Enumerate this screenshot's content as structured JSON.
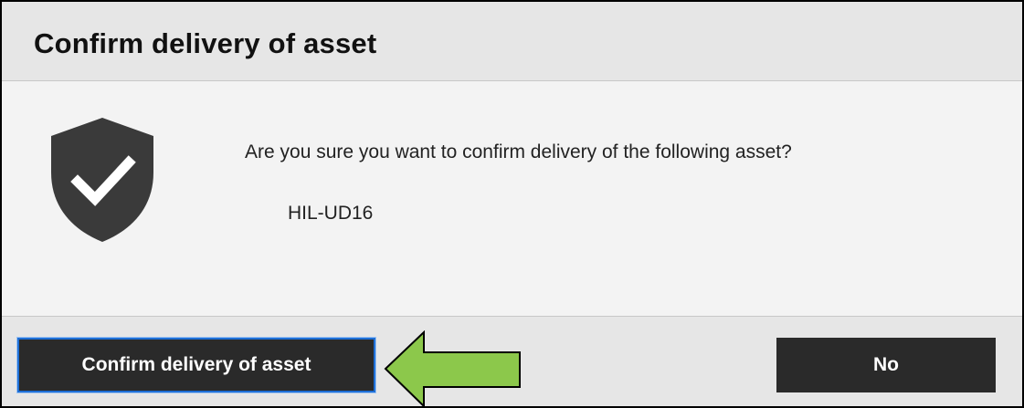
{
  "dialog": {
    "title": "Confirm delivery of asset",
    "message": "Are you sure you want to confirm delivery of the following asset?",
    "asset_name": "HIL-UD16",
    "icon": "shield-check-icon"
  },
  "buttons": {
    "confirm_label": "Confirm delivery of asset",
    "no_label": "No"
  },
  "annotation": {
    "arrow_icon": "green-arrow-icon",
    "arrow_color": "#8cc84b"
  },
  "colors": {
    "button_bg": "#2a2a2a",
    "header_bg": "#e6e6e6",
    "body_bg": "#f3f3f3",
    "shield": "#3a3a3a"
  }
}
